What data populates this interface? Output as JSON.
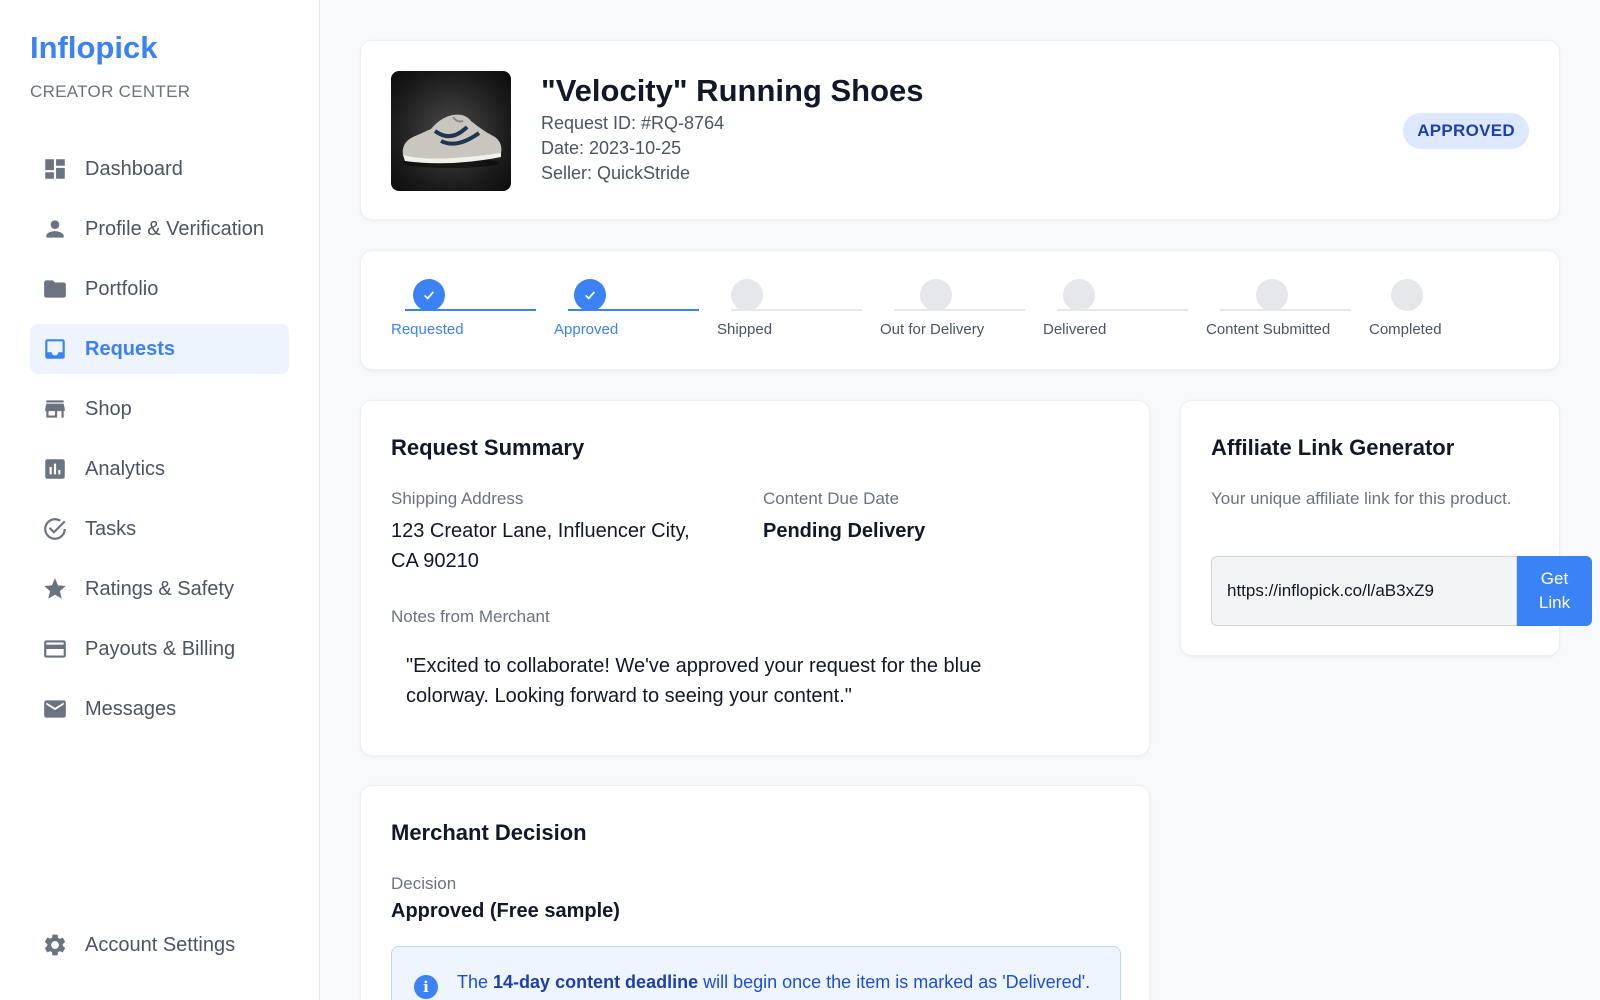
{
  "sidebar": {
    "brand": "Inflopick",
    "subtitle": "CREATOR CENTER",
    "items": [
      {
        "label": "Dashboard",
        "icon": "dashboard-icon"
      },
      {
        "label": "Profile & Verification",
        "icon": "person-icon"
      },
      {
        "label": "Portfolio",
        "icon": "folder-icon"
      },
      {
        "label": "Requests",
        "icon": "inbox-icon",
        "active": true
      },
      {
        "label": "Shop",
        "icon": "store-icon"
      },
      {
        "label": "Analytics",
        "icon": "bar-chart-icon"
      },
      {
        "label": "Tasks",
        "icon": "check-circle-icon"
      },
      {
        "label": "Ratings & Safety",
        "icon": "star-icon"
      },
      {
        "label": "Payouts & Billing",
        "icon": "credit-card-icon"
      },
      {
        "label": "Messages",
        "icon": "mail-icon"
      }
    ],
    "settings": {
      "label": "Account Settings",
      "icon": "gear-icon"
    }
  },
  "product": {
    "title": "\"Velocity\" Running Shoes",
    "request_id": "Request ID: #RQ-8764",
    "date": "Date: 2023-10-25",
    "seller": "Seller: QuickStride",
    "status": "APPROVED",
    "image": "running-shoe-image"
  },
  "progress": {
    "steps": [
      {
        "label": "Requested",
        "done": true
      },
      {
        "label": "Approved",
        "done": true
      },
      {
        "label": "Shipped",
        "done": false
      },
      {
        "label": "Out for Delivery",
        "done": false
      },
      {
        "label": "Delivered",
        "done": false
      },
      {
        "label": "Content Submitted",
        "done": false
      },
      {
        "label": "Completed",
        "done": false
      }
    ]
  },
  "summary": {
    "title": "Request Summary",
    "shipping_label": "Shipping Address",
    "shipping_line1": "123 Creator Lane, Influencer City,",
    "shipping_line2": "CA 90210",
    "due_label": "Content Due Date",
    "due_value": "Pending Delivery",
    "notes_label": "Notes from Merchant",
    "notes_line1": "\"Excited to collaborate! We've approved your request for the blue",
    "notes_line2": "colorway. Looking forward to seeing your content.\""
  },
  "affiliate": {
    "title": "Affiliate Link Generator",
    "description": "Your unique affiliate link for this product.",
    "link": "https://inflopick.co/l/aB3xZ9",
    "button_line1": "Get",
    "button_line2": "Link"
  },
  "decision": {
    "title": "Merchant Decision",
    "label": "Decision",
    "value": "Approved (Free sample)",
    "info_prefix": "The ",
    "info_bold": "14-day content deadline",
    "info_suffix": " will begin once the item is marked as 'Delivered'."
  },
  "colors": {
    "accent": "#3b82f6",
    "badge_bg": "#dbe8fd",
    "badge_text": "#1e40af"
  }
}
